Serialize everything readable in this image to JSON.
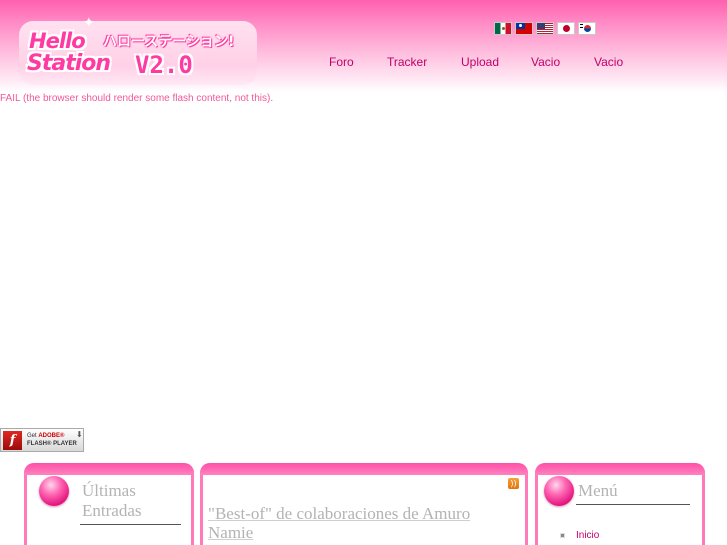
{
  "logo": {
    "hello": "Hello",
    "station": "Station",
    "katakana": "ハローステーション!",
    "version": "V2.0"
  },
  "flags": [
    {
      "icon": "flag-mexico-icon"
    },
    {
      "icon": "flag-taiwan-icon"
    },
    {
      "icon": "flag-usa-icon"
    },
    {
      "icon": "flag-japan-icon"
    },
    {
      "icon": "flag-korea-icon"
    }
  ],
  "nav": {
    "items": [
      {
        "label": "Foro"
      },
      {
        "label": "Tracker"
      },
      {
        "label": "Upload"
      },
      {
        "label": "Vacio"
      },
      {
        "label": "Vacio"
      }
    ]
  },
  "flash": {
    "fail_message": "FAIL (the browser should render some flash content, not this).",
    "badge_get": "Get",
    "badge_brand": "ADOBE®",
    "badge_player": "FLASH® PLAYER"
  },
  "left_panel": {
    "title_line1": "Últimas",
    "title_line2": "Entradas"
  },
  "main_panel": {
    "post_title_line1": "\"Best-of\" de colaboraciones de Amuro",
    "post_title_line2": "Namie"
  },
  "right_panel": {
    "title": "Menú",
    "items": [
      {
        "label": "Inicio"
      }
    ]
  },
  "colors": {
    "brand_pink": "#ff4fa6",
    "link": "#c2006b",
    "fail_text": "#f0589a"
  }
}
